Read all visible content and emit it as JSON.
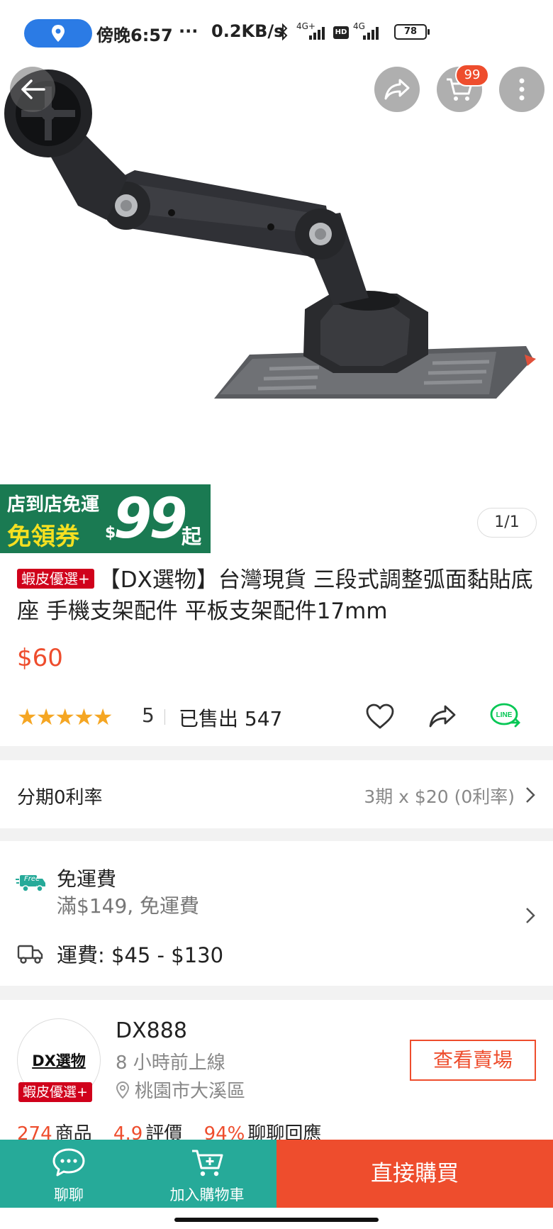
{
  "status_bar": {
    "time": "傍晚6:57",
    "dots": "···",
    "speed": "0.2KB/s",
    "signal_1": "4G+",
    "hd": "HD",
    "signal_2": "4G",
    "battery": "78"
  },
  "top_actions": {
    "cart_count": "99"
  },
  "promo_banner": {
    "line1": "店到店免運",
    "line2": "免領券",
    "dollar": "$",
    "amount": "99",
    "suffix": "起"
  },
  "gallery": {
    "page_indicator": "1/1"
  },
  "product": {
    "badge": "蝦皮優選+",
    "title": "【DX選物】台灣現貨 三段式調整弧面黏貼底座 手機支架配件 平板支架配件17mm",
    "price": "$60",
    "rating": 5,
    "rating_label": "5",
    "stars": "★★★★★",
    "sold": "已售出 547"
  },
  "installment": {
    "label": "分期0利率",
    "value": "3期 x $20 (0利率)"
  },
  "shipping": {
    "free_icon_label": "Free",
    "free_title": "免運費",
    "free_condition": "滿$149, 免運費",
    "fee": "運費: $45 - $130"
  },
  "shop": {
    "avatar_name": "DX選物",
    "badge": "蝦皮優選+",
    "name": "DX888",
    "online": "8 小時前上線",
    "location": "桃園市大溪區",
    "view_button": "查看賣場",
    "stats": [
      {
        "value": "274",
        "label": "商品"
      },
      {
        "value": "4.9",
        "label": "評價"
      },
      {
        "value": "94%",
        "label": "聊聊回應"
      }
    ]
  },
  "bottom_bar": {
    "chat": "聊聊",
    "add_to_cart": "加入購物車",
    "buy_now": "直接購買"
  },
  "colors": {
    "brand": "#ee4d2d",
    "teal": "#26aa99",
    "star": "#f5a623",
    "line_green": "#06c755"
  }
}
